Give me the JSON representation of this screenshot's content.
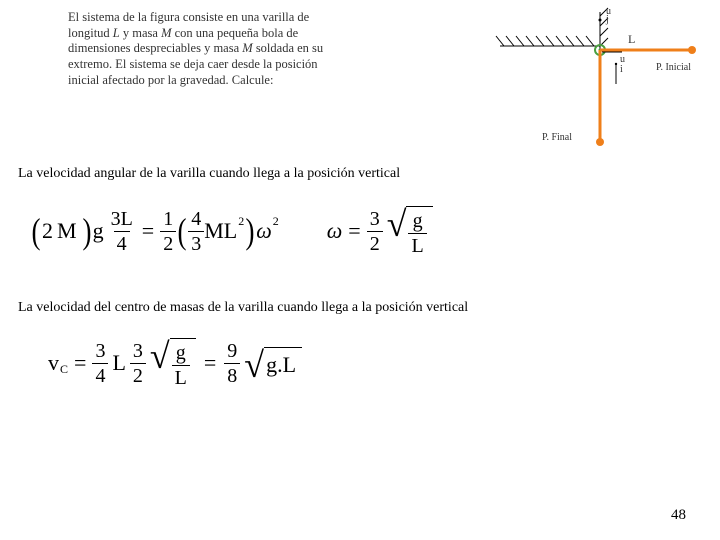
{
  "problem": {
    "line1": "El sistema de la figura consiste en una varilla de",
    "line2_a": "longitud ",
    "line2_L": "L",
    "line2_b": " y masa ",
    "line2_M": "M",
    "line2_c": " con una pequeña bola de",
    "line3_a": "dimensiones despreciables y masa ",
    "line3_M": "M",
    "line3_b": " soldada en su",
    "line4": "extremo. El sistema se deja caer desde la posición",
    "line5": "inicial afectado por la gravedad. Calcule:"
  },
  "subhead1": "La velocidad angular de la varilla cuando llega a la posición vertical",
  "subhead2": "La velocidad del centro de masas de la varilla cuando llega a la posición vertical",
  "diagram": {
    "j": "j",
    "i": "i",
    "u1": "u",
    "u2": "u",
    "L": "L",
    "pinicial": "P. Inicial",
    "pfinal": "P. Final"
  },
  "eq1": {
    "twoM": "2",
    "M": "M",
    "g": "g",
    "f1_num": "3L",
    "f1_den": "4",
    "eq": "=",
    "f2_num": "1",
    "f2_den": "2",
    "f3_num": "4",
    "f3_den": "3",
    "ML": "ML",
    "sq": "2",
    "omega": "ω",
    "sq2": "2"
  },
  "eq1b": {
    "omega": "ω",
    "eq": "=",
    "f_num": "3",
    "f_den": "2",
    "g": "g",
    "L": "L"
  },
  "eq2": {
    "v": "v",
    "C": "C",
    "eq1": "=",
    "f1_num": "3",
    "f1_den": "4",
    "L": "L",
    "f2_num": "3",
    "f2_den": "2",
    "sg": "g",
    "sL": "L",
    "eq2": "=",
    "f3_num": "9",
    "f3_den": "8",
    "gL": "g.L"
  },
  "page": "48"
}
